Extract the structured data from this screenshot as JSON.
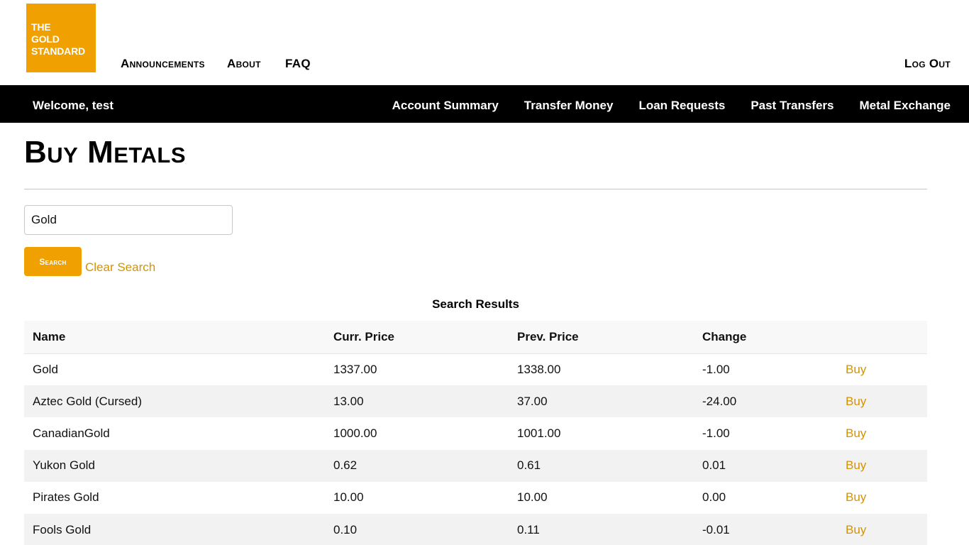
{
  "logo": {
    "line1": "THE",
    "line2": "GOLD",
    "line3": "STANDARD"
  },
  "top_nav": {
    "announcements": "Announcements",
    "about": "About",
    "faq": "FAQ",
    "logout": "Log Out"
  },
  "account_bar": {
    "welcome": "Welcome, test",
    "items": [
      "Account Summary",
      "Transfer Money",
      "Loan Requests",
      "Past Transfers",
      "Metal Exchange"
    ]
  },
  "page": {
    "title": "Buy Metals"
  },
  "search": {
    "value": "Gold",
    "button_label": "Search",
    "clear_label": "Clear Search"
  },
  "results": {
    "caption": "Search Results",
    "columns": [
      "Name",
      "Curr. Price",
      "Prev. Price",
      "Change",
      ""
    ],
    "buy_label": "Buy",
    "rows": [
      {
        "name": "Gold",
        "curr": "1337.00",
        "prev": "1338.00",
        "change": "-1.00"
      },
      {
        "name": "Aztec Gold (Cursed)",
        "curr": "13.00",
        "prev": "37.00",
        "change": "-24.00"
      },
      {
        "name": "CanadianGold",
        "curr": "1000.00",
        "prev": "1001.00",
        "change": "-1.00"
      },
      {
        "name": "Yukon Gold",
        "curr": "0.62",
        "prev": "0.61",
        "change": "0.01"
      },
      {
        "name": "Pirates Gold",
        "curr": "10.00",
        "prev": "10.00",
        "change": "0.00"
      },
      {
        "name": "Fools Gold",
        "curr": "0.10",
        "prev": "0.11",
        "change": "-0.01"
      }
    ]
  },
  "colors": {
    "brand_gold": "#f0a000",
    "link_gold": "#d49300",
    "nav_bar": "#000000"
  }
}
